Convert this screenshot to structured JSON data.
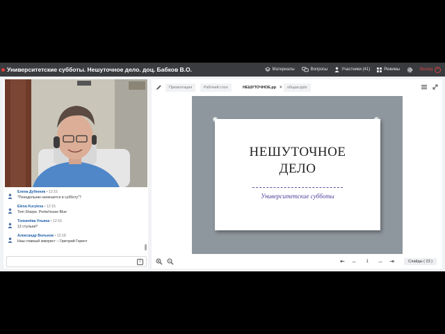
{
  "header": {
    "title": "Университетские субботы. Нешуточное дело. доц. Бабков В.О.",
    "nav": {
      "materials": "Материалы",
      "questions": "Вопросы",
      "participants": "Участники (41)",
      "modes": "Режимы",
      "exit": "Выход"
    },
    "colors": {
      "bar": "#3a3b3f",
      "exit": "#d94545",
      "rec": "#e23b3b"
    }
  },
  "chat": {
    "messages": [
      {
        "name": "Елена Дубюник",
        "time": "12:15",
        "text": "\"Понедельник начинается в субботу\"?"
      },
      {
        "name": "Elena Kuryleva",
        "time": "12:15",
        "text": "Tom Sharpe. Porterhouse Blue"
      },
      {
        "name": "Толкачёва Ульяна",
        "time": "12:16",
        "text": "12 стульев?"
      },
      {
        "name": "Александр Вольнов",
        "time": "12:18",
        "text": "Наш главный юморист -- Григорий Горинт"
      }
    ],
    "input_placeholder": ""
  },
  "presentation": {
    "tabs": {
      "presentation": "Презентация",
      "desktop": "Рабочий стол",
      "active_file": "НЕШУТОЧНОЕ.pp",
      "other_file": "общая.pptx"
    },
    "slide": {
      "title_line1": "НЕШУТОЧНОЕ",
      "title_line2": "ДЕЛО",
      "subtitle": "Университетские субботы"
    },
    "page": "1",
    "slides_label": "Слайды ( 23 )"
  },
  "icons": {
    "nav": [
      "layers-icon",
      "chat-bubbles-icon",
      "user-icon",
      "grid-icon",
      "gear-icon",
      "close-circle-icon"
    ],
    "chat": [
      "user-icon",
      "emoji-icon"
    ],
    "toolbar": [
      "pen-icon",
      "menu-icon",
      "fullscreen-icon",
      "zoom-in-icon",
      "zoom-out-icon",
      "first-page-icon",
      "prev-page-icon",
      "next-page-icon",
      "last-page-icon"
    ]
  }
}
